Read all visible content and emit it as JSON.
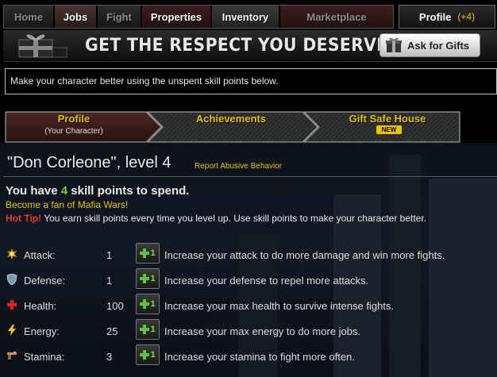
{
  "nav": {
    "tabs": [
      {
        "label": "Home",
        "state": "dim"
      },
      {
        "label": "Jobs",
        "state": "active"
      },
      {
        "label": "Fight",
        "state": "dim"
      },
      {
        "label": "Properties",
        "state": "normal"
      },
      {
        "label": "Inventory",
        "state": "normal"
      },
      {
        "label": "Marketplace",
        "state": "dim"
      }
    ],
    "profile_label": "Profile",
    "profile_badge": "(+4)"
  },
  "banner": {
    "title": "GET THE RESPECT YOU DESERVE!",
    "ask_label": "Ask for Gifts"
  },
  "info_text": "Make your character better using the unspent skill points below.",
  "subtabs": [
    {
      "label": "Profile",
      "sub": "(Your Character)"
    },
    {
      "label": "Achievements",
      "sub": ""
    },
    {
      "label": "Gift Safe House",
      "badge": "NEW"
    }
  ],
  "character": {
    "name_line": "\"Don Corleone\", level 4",
    "report_link": "Report Abusive Behavior"
  },
  "skills": {
    "prefix": "You have",
    "points": "4",
    "suffix": "skill points to spend.",
    "fan_link": "Become a fan of Mafia Wars!",
    "tip_label": "Hot Tip!",
    "tip_text": "You earn skill points every time you level up. Use skill points to make your character better."
  },
  "stats": [
    {
      "name": "Attack:",
      "value": "1",
      "button": "1",
      "desc": "Increase your attack to do more damage and win more fights.",
      "icon": "burst-icon"
    },
    {
      "name": "Defense:",
      "value": "1",
      "button": "1",
      "desc": "Increase your defense to repel more attacks.",
      "icon": "shield-icon"
    },
    {
      "name": "Health:",
      "value": "100",
      "button": "1",
      "desc": "Increase your max health to survive intense fights.",
      "icon": "health-cross-icon"
    },
    {
      "name": "Energy:",
      "value": "25",
      "button": "1",
      "desc": "Increase your max energy to do more jobs.",
      "icon": "lightning-icon"
    },
    {
      "name": "Stamina:",
      "value": "3",
      "button": "1",
      "desc": "Increase your stamina to fight more often.",
      "icon": "gun-icon"
    }
  ],
  "colors": {
    "gold": "#e6c200",
    "green": "#69d34a",
    "red": "#e23b2e"
  }
}
